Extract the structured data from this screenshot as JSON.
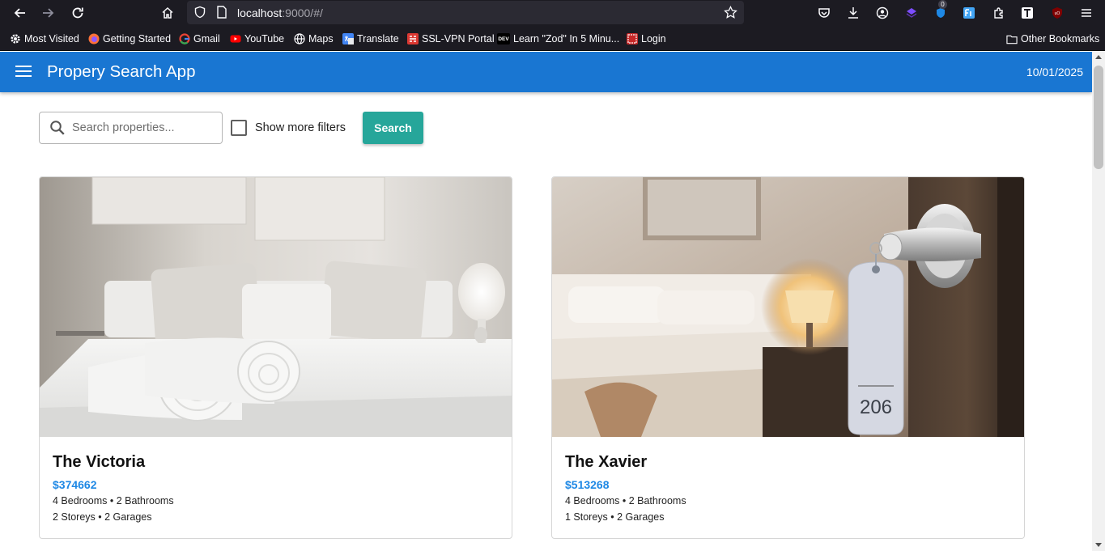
{
  "browser": {
    "url_host": "localhost",
    "url_rest": ":9000/#/",
    "extension_badge": "0",
    "bookmarks": [
      {
        "label": "Most Visited",
        "icon": "gear-icon"
      },
      {
        "label": "Getting Started",
        "icon": "firefox-icon"
      },
      {
        "label": "Gmail",
        "icon": "google-icon"
      },
      {
        "label": "YouTube",
        "icon": "youtube-icon"
      },
      {
        "label": "Maps",
        "icon": "globe-icon"
      },
      {
        "label": "Translate",
        "icon": "translate-icon"
      },
      {
        "label": "SSL-VPN Portal",
        "icon": "vpn-icon"
      },
      {
        "label": "Learn \"Zod\" In 5 Minu...",
        "icon": "dev-icon"
      },
      {
        "label": "Login",
        "icon": "login-icon"
      }
    ],
    "other_bookmarks": "Other Bookmarks",
    "dev_icon_text": "DEV"
  },
  "app": {
    "title": "Propery Search App",
    "date": "10/01/2025",
    "brand_color": "#1976d2",
    "search": {
      "placeholder": "Search properties...",
      "value": ""
    },
    "filters_label": "Show more filters",
    "filters_checked": false,
    "search_button": "Search",
    "search_button_color": "#26a69a"
  },
  "properties": [
    {
      "title": "The Victoria",
      "price": "$374662",
      "rooms": "4 Bedrooms • 2 Bathrooms",
      "levels": "2 Storeys • 2 Garages",
      "image": "bedroom-with-rolled-towels"
    },
    {
      "title": "The Xavier",
      "price": "$513268",
      "rooms": "4 Bedrooms • 2 Bathrooms",
      "levels": "1 Storeys • 2 Garages",
      "image": "hotel-room-door-with-key-tag",
      "tag_number": "206"
    }
  ]
}
